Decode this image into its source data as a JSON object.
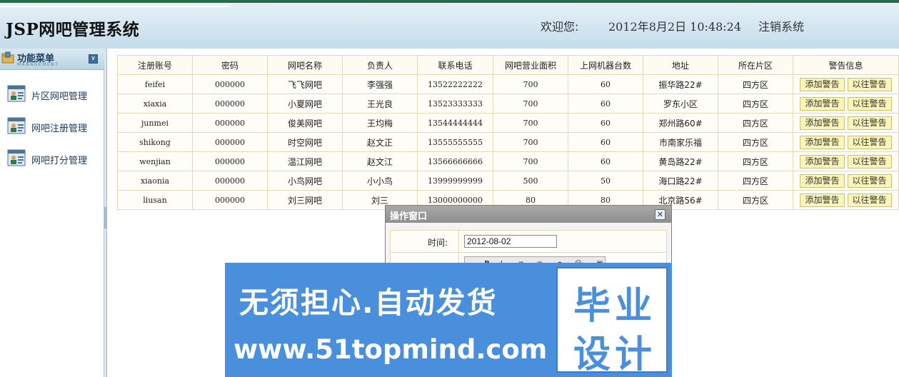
{
  "header": {
    "title": "JSP网吧管理系统",
    "welcome": "欢迎您:",
    "datetime": "2012年8月2日  10:48:24",
    "logout": "注销系统"
  },
  "sidebar": {
    "menu_title": "功能菜单",
    "menu_subtitle": "MANAGEMENT",
    "items": [
      {
        "label": "片区网吧管理",
        "icon": "user-card-icon"
      },
      {
        "label": "网吧注册管理",
        "icon": "user-card-icon"
      },
      {
        "label": "网吧打分管理",
        "icon": "user-card-icon"
      }
    ]
  },
  "table": {
    "headers": [
      "注册账号",
      "密码",
      "网吧名称",
      "负责人",
      "联系电话",
      "网吧营业面积",
      "上网机器台数",
      "地址",
      "所在片区",
      "警告信息"
    ],
    "add_label": "添加警告",
    "history_label": "以往警告",
    "rows": [
      [
        "feifei",
        "000000",
        "飞飞网吧",
        "李强强",
        "13522222222",
        "700",
        "60",
        "振华路22#",
        "四方区"
      ],
      [
        "xiaxia",
        "000000",
        "小夏网吧",
        "王光良",
        "13523333333",
        "700",
        "60",
        "罗东小区",
        "四方区"
      ],
      [
        "junmei",
        "000000",
        "俊美网吧",
        "王均梅",
        "13544444444",
        "700",
        "60",
        "郑州路60#",
        "四方区"
      ],
      [
        "shikong",
        "000000",
        "时空网吧",
        "赵文正",
        "13555555555",
        "700",
        "60",
        "市南家乐福",
        "四方区"
      ],
      [
        "wenjian",
        "000000",
        "温江网吧",
        "赵文江",
        "13566666666",
        "700",
        "60",
        "黄岛路22#",
        "四方区"
      ],
      [
        "xiaonia",
        "000000",
        "小鸟网吧",
        "小小鸟",
        "13999999999",
        "500",
        "50",
        "海口路22#",
        "四方区"
      ],
      [
        "liusan",
        "000000",
        "刘三网吧",
        "刘三",
        "13000000000",
        "80",
        "80",
        "北京路56#",
        "四方区"
      ]
    ]
  },
  "dialog": {
    "title": "操作窗口",
    "time_label": "时间:",
    "time_value": "2012-08-02"
  },
  "watermark": {
    "line1": "无须担心.自动发货",
    "line2": "www.51topmind.com",
    "box_top": "毕业",
    "box_bottom": "设计"
  },
  "colors": {
    "header_bg": "#c4dceb",
    "header_border": "#2b6a48",
    "table_border": "#e3d9b8",
    "warn_button_bg": "#fbf6b8",
    "watermark_bg": "#4a8fdc"
  }
}
